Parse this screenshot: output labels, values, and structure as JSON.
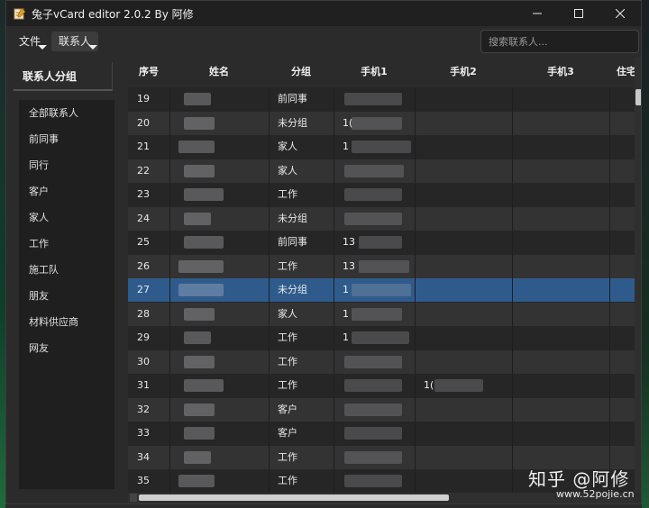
{
  "window": {
    "title": "兔子vCard editor 2.0.2 By 阿修"
  },
  "menus": {
    "file": "文件",
    "contacts": "联系人"
  },
  "search": {
    "placeholder": "搜索联系人..."
  },
  "sidebar": {
    "header": "联系人分组",
    "groups": [
      "全部联系人",
      "前同事",
      "同行",
      "客户",
      "家人",
      "工作",
      "施工队",
      "朋友",
      "材料供应商",
      "网友"
    ]
  },
  "table": {
    "columns": [
      "序号",
      "姓名",
      "分组",
      "手机1",
      "手机2",
      "手机3",
      "住宅"
    ],
    "rows": [
      {
        "num": "19",
        "group": "前同事",
        "phone1": ""
      },
      {
        "num": "20",
        "group": "未分组",
        "phone1": "1("
      },
      {
        "num": "21",
        "group": "家人",
        "phone1": "1"
      },
      {
        "num": "22",
        "group": "家人",
        "phone1": ""
      },
      {
        "num": "23",
        "group": "工作",
        "phone1": ""
      },
      {
        "num": "24",
        "group": "未分组",
        "phone1": ""
      },
      {
        "num": "25",
        "group": "前同事",
        "phone1": "13"
      },
      {
        "num": "26",
        "group": "工作",
        "phone1": "13"
      },
      {
        "num": "27",
        "group": "未分组",
        "phone1": "1"
      },
      {
        "num": "28",
        "group": "家人",
        "phone1": "1"
      },
      {
        "num": "29",
        "group": "工作",
        "phone1": "1"
      },
      {
        "num": "30",
        "group": "工作",
        "phone1": ""
      },
      {
        "num": "31",
        "group": "工作",
        "phone1": "",
        "phone2": "1("
      },
      {
        "num": "32",
        "group": "客户",
        "phone1": ""
      },
      {
        "num": "33",
        "group": "客户",
        "phone1": ""
      },
      {
        "num": "34",
        "group": "工作",
        "phone1": ""
      },
      {
        "num": "35",
        "group": "工作",
        "phone1": ""
      }
    ],
    "selected_num": "27"
  },
  "watermark": {
    "main": "知乎 @阿修",
    "site": "www.52pojie.cn"
  },
  "colors": {
    "selected_row": "#2f5b8c",
    "background": "#2b2b2b"
  },
  "icons": {
    "app": "notepad-pencil-icon",
    "minimize": "minimize-icon",
    "maximize": "maximize-icon",
    "close": "close-icon"
  }
}
